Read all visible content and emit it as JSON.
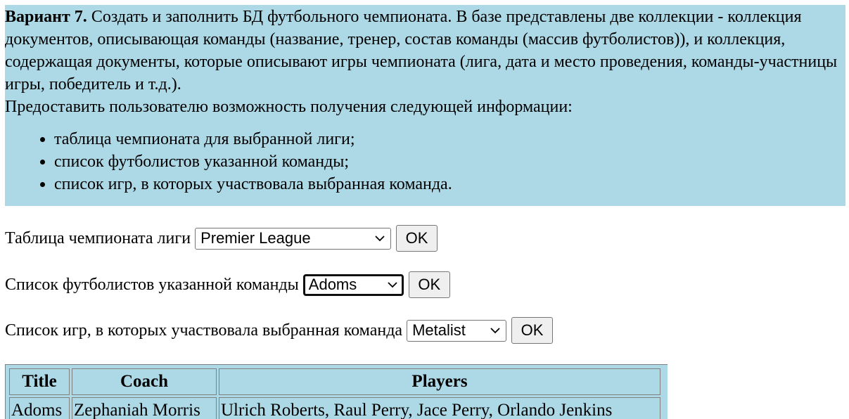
{
  "task": {
    "variant_label": "Вариант 7.",
    "description": " Создать и заполнить БД футбольного чемпионата. В базе представлены две коллекции - коллекция документов, описывающая команды (название, тренер, состав команды (массив футболистов)), и коллекция, содержащая документы, которые описывают игры чемпионата (лига, дата и место проведения, команды-участницы игры, победитель и т.д.).",
    "prompt": "Предоставить пользователю возможность получения следующей информации:",
    "items": [
      "таблица чемпионата для выбранной лиги;",
      "список футболистов указанной команды;",
      "список игр, в которых участвовала выбранная команда."
    ]
  },
  "forms": {
    "league": {
      "label": "Таблица чемпионата лиги",
      "selected": "Premier League",
      "button": "OK"
    },
    "players": {
      "label": "Список футболистов указанной команды",
      "selected": "Adoms",
      "button": "OK"
    },
    "games": {
      "label": "Список игр, в которых участвовала выбранная команда",
      "selected": "Metalist",
      "button": "OK"
    }
  },
  "table": {
    "headers": [
      "Title",
      "Coach",
      "Players"
    ],
    "rows": [
      [
        "Adoms",
        "Zephaniah Morris",
        "Ulrich Roberts, Raul Perry, Jace Perry, Orlando Jenkins"
      ]
    ]
  },
  "colors": {
    "panel_background": "#add8e6",
    "button_background": "#efefef"
  }
}
